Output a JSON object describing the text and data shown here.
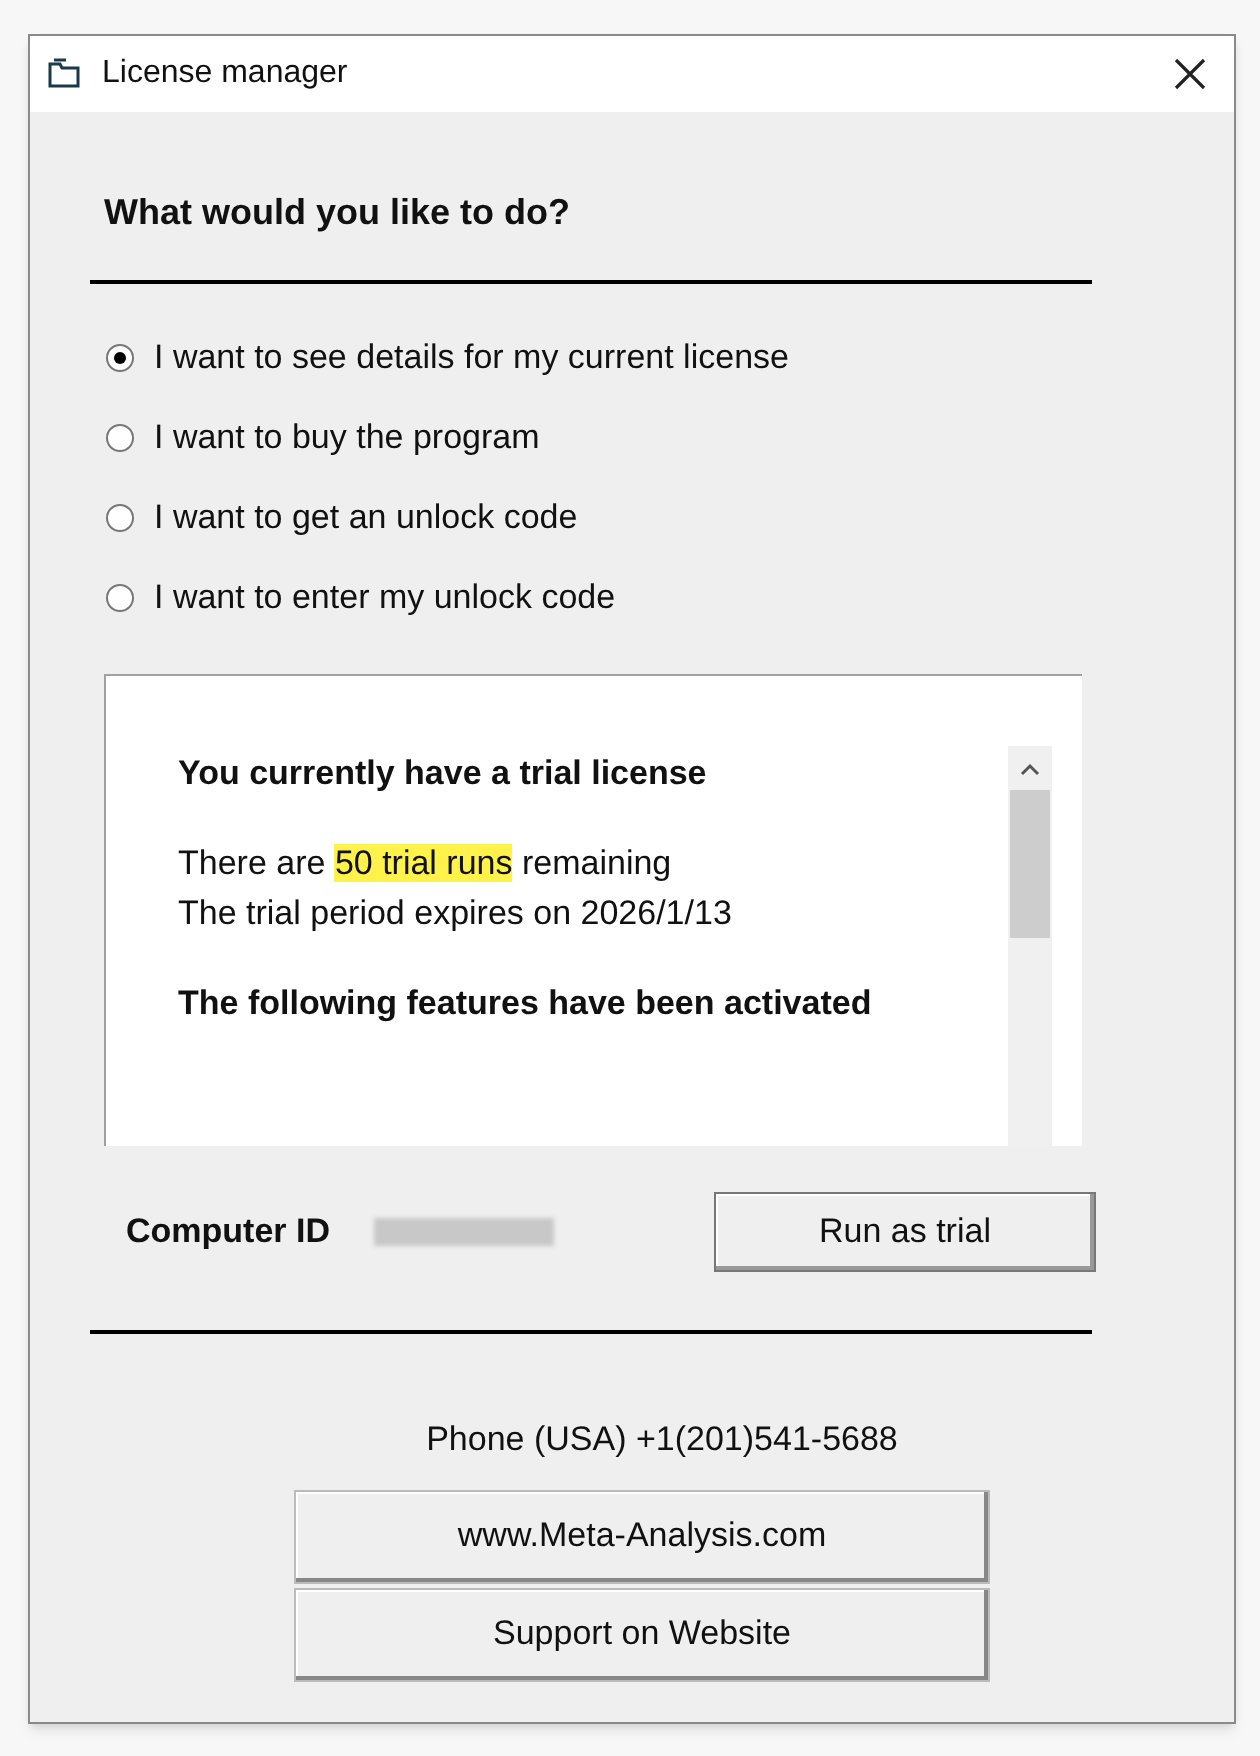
{
  "window": {
    "title": "License manager"
  },
  "heading": "What would you like to do?",
  "options": [
    {
      "label": "I want to see details for my current license",
      "selected": true
    },
    {
      "label": "I want to buy the program",
      "selected": false
    },
    {
      "label": "I want to get an unlock code",
      "selected": false
    },
    {
      "label": "I want to enter my unlock code",
      "selected": false
    }
  ],
  "details": [
    {
      "kind": "heading",
      "text": "You currently have a trial license"
    },
    {
      "kind": "line",
      "text": "There are ",
      "highlight": "50 trial runs",
      "after": " remaining"
    },
    {
      "kind": "line",
      "text": "The trial period expires on 2026/1/13"
    },
    {
      "kind": "heading",
      "text": "The following features have been activated"
    }
  ],
  "computer_id": {
    "label": "Computer ID"
  },
  "run_button": "Run as trial",
  "phone": "Phone (USA) +1(201)541-5688",
  "link_buttons": [
    "www.Meta-Analysis.com",
    "Support on Website"
  ]
}
